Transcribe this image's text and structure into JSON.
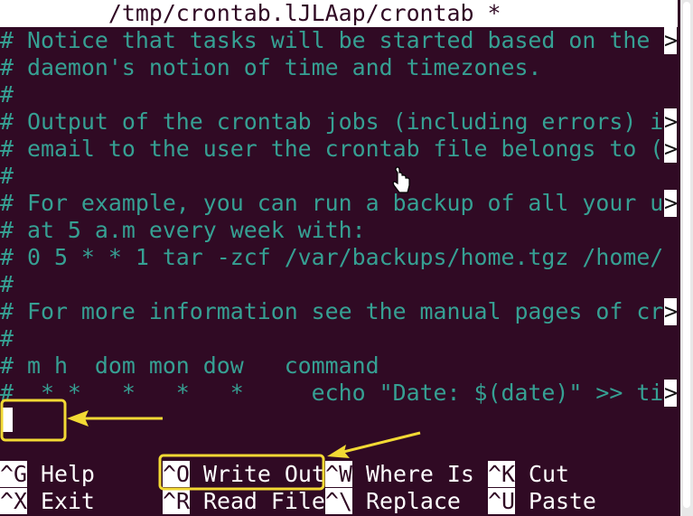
{
  "title": "        /tmp/crontab.lJLAap/crontab *",
  "lines": [
    {
      "text": "# Notice that tasks will be started based on the ",
      "truncated": true
    },
    {
      "text": "# daemon's notion of time and timezones.",
      "truncated": false
    },
    {
      "text": "#",
      "truncated": false
    },
    {
      "text": "# Output of the crontab jobs (including errors) i",
      "truncated": true
    },
    {
      "text": "# email to the user the crontab file belongs to (",
      "truncated": true
    },
    {
      "text": "#",
      "truncated": false
    },
    {
      "text": "# For example, you can run a backup of all your u",
      "truncated": true
    },
    {
      "text": "# at 5 a.m every week with:",
      "truncated": false
    },
    {
      "text": "# 0 5 * * 1 tar -zcf /var/backups/home.tgz /home/",
      "truncated": false
    },
    {
      "text": "#",
      "truncated": false
    },
    {
      "text": "# For more information see the manual pages of cr",
      "truncated": true
    },
    {
      "text": "#",
      "truncated": false
    },
    {
      "text": "# m h  dom mon dow   command",
      "truncated": false
    },
    {
      "text": "#  * *   *   *   *     echo \"Date: $(date)\" >> ti",
      "truncated": true
    }
  ],
  "truncation_marker": ">",
  "shortcuts": [
    [
      {
        "key": "^G",
        "label": " Help"
      },
      {
        "key": "^O",
        "label": " Write Out"
      },
      {
        "key": "^W",
        "label": " Where Is"
      },
      {
        "key": "^K",
        "label": " Cut"
      }
    ],
    [
      {
        "key": "^X",
        "label": " Exit"
      },
      {
        "key": "^R",
        "label": " Read File"
      },
      {
        "key": "^\\",
        "label": " Replace"
      },
      {
        "key": "^U",
        "label": " Paste"
      }
    ]
  ],
  "colors": {
    "background": "#300a24",
    "text": "#36a093",
    "annotation": "#f2d934"
  }
}
